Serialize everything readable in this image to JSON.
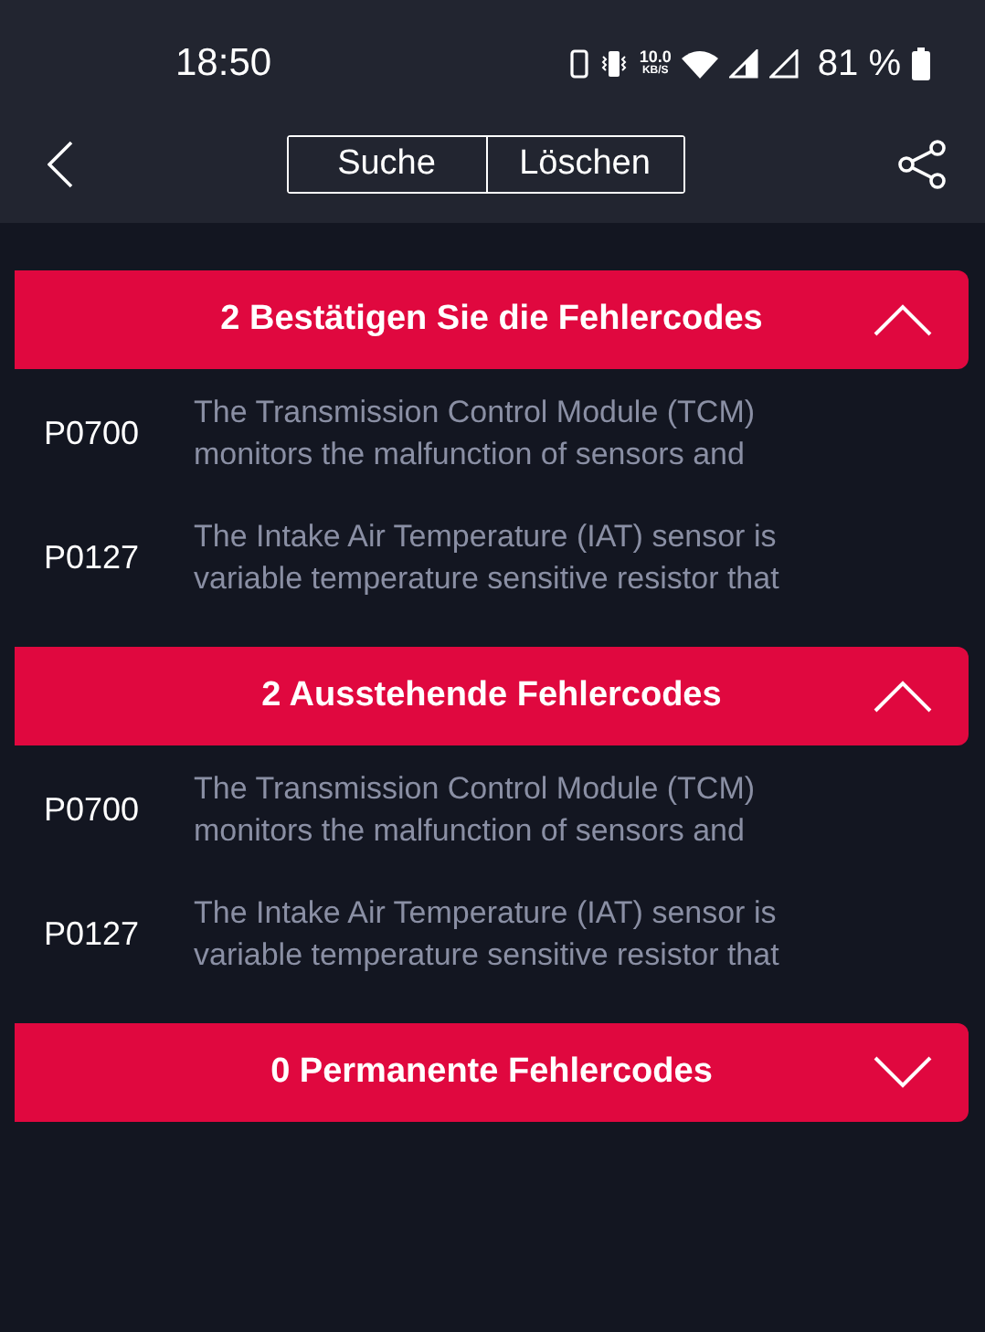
{
  "status_bar": {
    "time": "18:50",
    "net_speed": "10.0",
    "net_unit": "KB/S",
    "battery": "81 %"
  },
  "toolbar": {
    "tabs": [
      {
        "label": "Suche",
        "selected": false
      },
      {
        "label": "Löschen",
        "selected": false
      }
    ]
  },
  "sections": [
    {
      "title": "2 Bestätigen Sie die Fehlercodes",
      "expanded": true,
      "codes": [
        {
          "code": "P0700",
          "description": "The Transmission Control Module (TCM)\nmonitors the malfunction of sensors and"
        },
        {
          "code": "P0127",
          "description": "The Intake Air Temperature (IAT) sensor is\nvariable temperature sensitive resistor that"
        }
      ]
    },
    {
      "title": "2 Ausstehende Fehlercodes",
      "expanded": true,
      "codes": [
        {
          "code": "P0700",
          "description": "The Transmission Control Module (TCM)\nmonitors the malfunction of sensors and"
        },
        {
          "code": "P0127",
          "description": "The Intake Air Temperature (IAT) sensor is\nvariable temperature sensitive resistor that"
        }
      ]
    },
    {
      "title": "0 Permanente Fehlercodes",
      "expanded": false
    }
  ]
}
